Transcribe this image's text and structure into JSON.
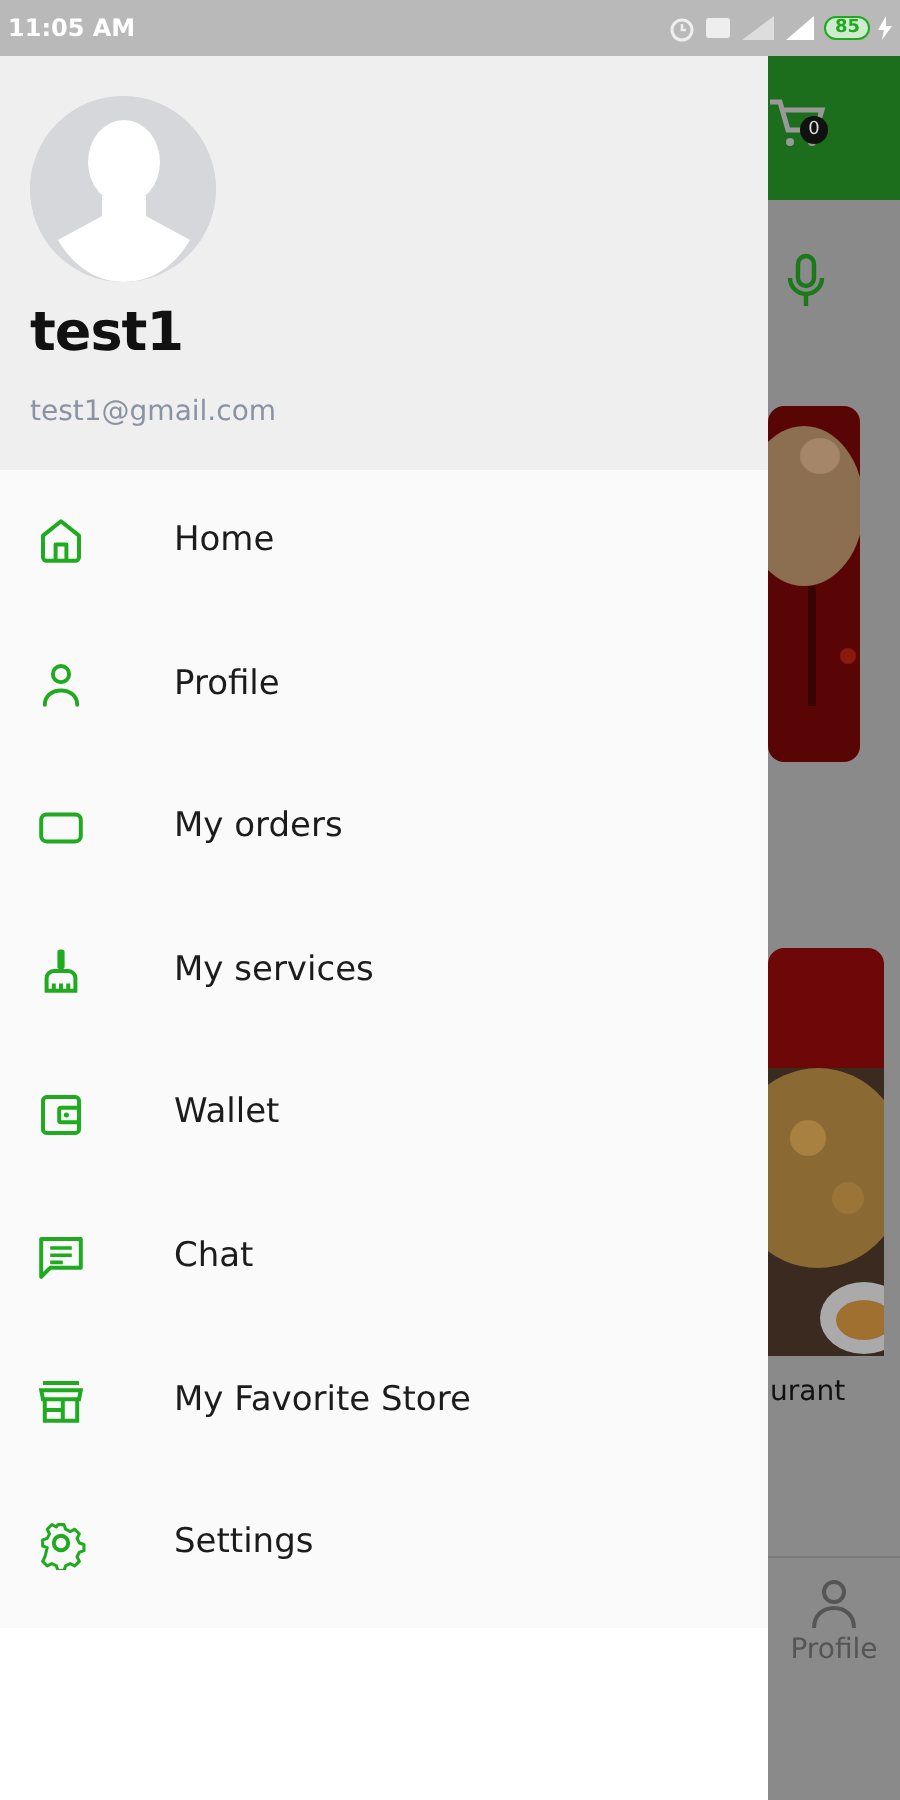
{
  "status_bar": {
    "time": "11:05 AM",
    "battery": "85"
  },
  "drawer": {
    "user_name": "test1",
    "email": "test1@gmail.com",
    "items": [
      {
        "label": "Home",
        "kind": "home"
      },
      {
        "label": "Profile",
        "kind": "person"
      },
      {
        "label": "My orders",
        "kind": "orders"
      },
      {
        "label": "My services",
        "kind": "broom"
      },
      {
        "label": "Wallet",
        "kind": "wallet"
      },
      {
        "label": "Chat",
        "kind": "chat"
      },
      {
        "label": "My Favorite Store",
        "kind": "store"
      },
      {
        "label": "Settings",
        "kind": "gear"
      }
    ]
  },
  "background_app": {
    "cart_count": "0",
    "card_caption": "urant",
    "bottom_nav": [
      {
        "label": "Profile"
      }
    ]
  }
}
